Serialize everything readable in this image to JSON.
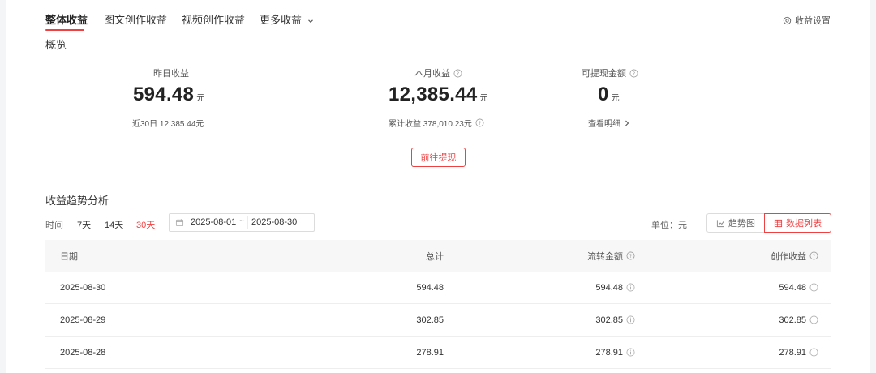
{
  "nav": {
    "tabs": [
      {
        "label": "整体收益"
      },
      {
        "label": "图文创作收益"
      },
      {
        "label": "视频创作收益"
      },
      {
        "label": "更多收益"
      }
    ],
    "settings_label": "收益设置"
  },
  "overview": {
    "title": "概览",
    "yesterday": {
      "label": "昨日收益",
      "value": "594.48",
      "unit": "元",
      "sub": "近30日 12,385.44元"
    },
    "month": {
      "label": "本月收益",
      "value": "12,385.44",
      "unit": "元",
      "sub": "累计收益 378,010.23元"
    },
    "withdrawable": {
      "label": "可提现金额",
      "value": "0",
      "unit": "元",
      "sub": "查看明细"
    },
    "withdraw_button": "前往提现"
  },
  "trend": {
    "title": "收益趋势分析",
    "time_label": "时间",
    "ranges": [
      "7天",
      "14天",
      "30天"
    ],
    "active_range": "30天",
    "date_start": "2025-08-01",
    "date_sep": "~",
    "date_end": "2025-08-30",
    "unit_label": "单位：元",
    "view_trend": "趋势图",
    "view_list": "数据列表"
  },
  "table": {
    "headers": {
      "date": "日期",
      "total": "总计",
      "flow": "流转金额",
      "create": "创作收益"
    },
    "rows": [
      {
        "date": "2025-08-30",
        "total": "594.48",
        "flow": "594.48",
        "create": "594.48"
      },
      {
        "date": "2025-08-29",
        "total": "302.85",
        "flow": "302.85",
        "create": "302.85"
      },
      {
        "date": "2025-08-28",
        "total": "278.91",
        "flow": "278.91",
        "create": "278.91"
      }
    ]
  },
  "colors": {
    "accent": "#f04142",
    "text": "#222222",
    "muted": "#666666",
    "header_bg": "#f7f7f8"
  }
}
